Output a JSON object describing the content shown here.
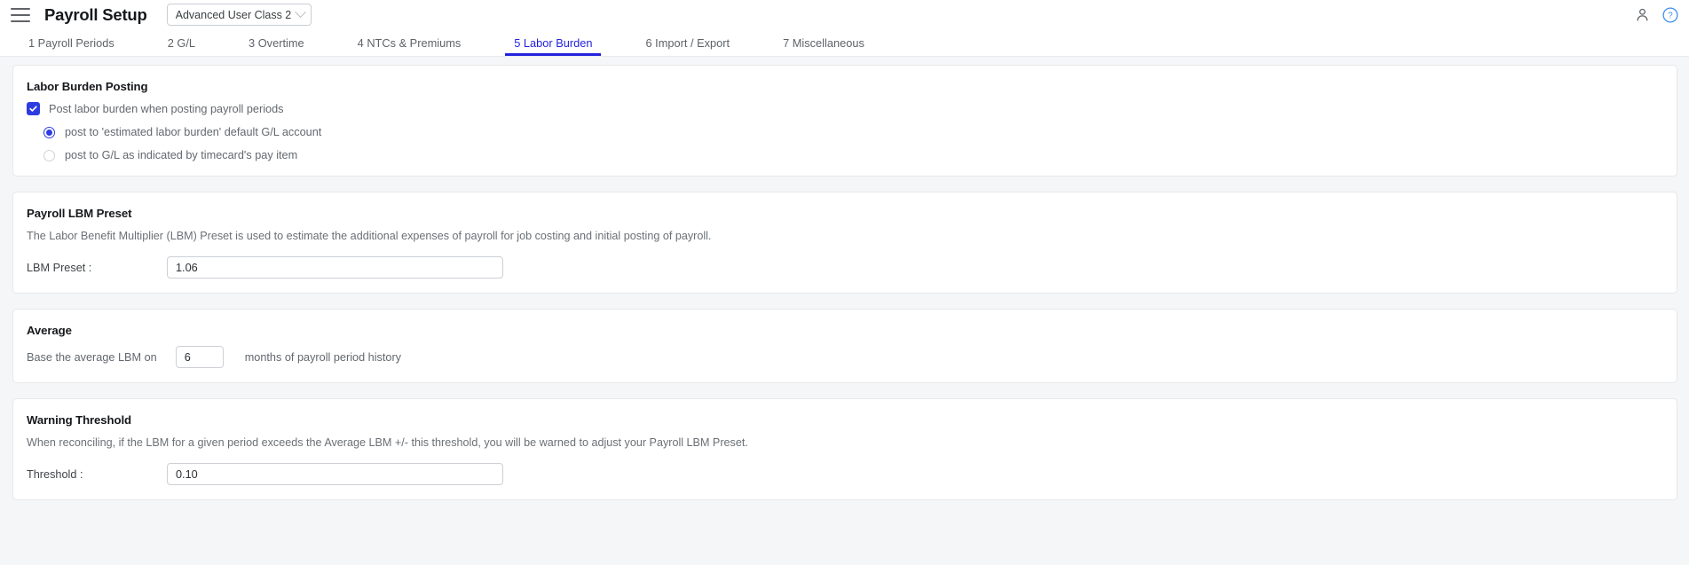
{
  "header": {
    "menu_icon": "hamburger-icon",
    "title": "Payroll Setup",
    "user_class": {
      "selected": "Advanced User Class 2",
      "chevron_icon": "chevron-down-icon"
    },
    "account_icon": "person-icon",
    "help_icon": "help-circle-icon",
    "accent_color": "#2323dd"
  },
  "tabs": [
    {
      "label": "1 Payroll Periods",
      "active": false
    },
    {
      "label": "2 G/L",
      "active": false
    },
    {
      "label": "3 Overtime",
      "active": false
    },
    {
      "label": "4 NTCs & Premiums",
      "active": false
    },
    {
      "label": "5 Labor Burden",
      "active": true
    },
    {
      "label": "6 Import / Export",
      "active": false
    },
    {
      "label": "7 Miscellaneous",
      "active": false
    }
  ],
  "labor_burden_posting": {
    "title": "Labor Burden Posting",
    "checkbox": {
      "label": "Post labor burden when posting payroll periods",
      "checked": true
    },
    "radios": [
      {
        "label": "post to 'estimated labor burden' default G/L account",
        "selected": true
      },
      {
        "label": "post to G/L as indicated by timecard's pay item",
        "selected": false
      }
    ]
  },
  "payroll_lbm_preset": {
    "title": "Payroll LBM Preset",
    "description": "The Labor Benefit Multiplier (LBM) Preset is used to estimate the additional expenses of payroll for job costing and initial posting of payroll.",
    "field_label": "LBM Preset :",
    "field_value": "1.06"
  },
  "average": {
    "title": "Average",
    "prefix_label": "Base the average LBM on",
    "field_value": "6",
    "suffix_label": "months of payroll period history"
  },
  "warning_threshold": {
    "title": "Warning Threshold",
    "description": "When reconciling, if the LBM for a given period exceeds the Average LBM +/- this threshold, you will be warned to adjust your Payroll LBM Preset.",
    "field_label": "Threshold :",
    "field_value": "0.10"
  }
}
